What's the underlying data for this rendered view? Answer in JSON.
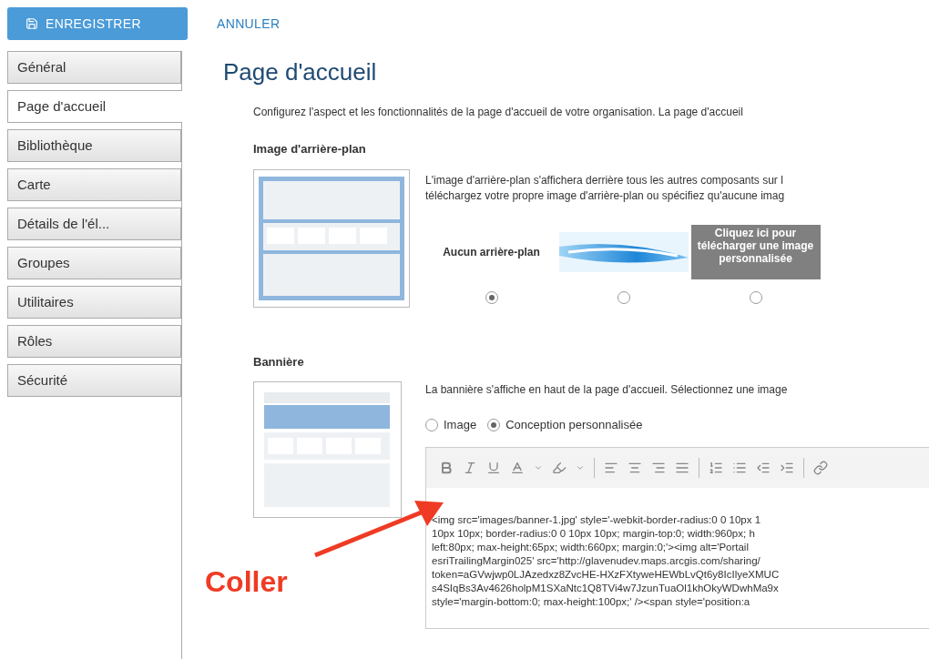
{
  "toolbar": {
    "save": {
      "label": "ENREGISTRER"
    },
    "cancel": {
      "label": "ANNULER"
    }
  },
  "sidebar": {
    "items": [
      {
        "label": "Général",
        "selected": false
      },
      {
        "label": "Page d'accueil",
        "selected": true
      },
      {
        "label": "Bibliothèque",
        "selected": false
      },
      {
        "label": "Carte",
        "selected": false
      },
      {
        "label": "Détails de l'él...",
        "selected": false
      },
      {
        "label": "Groupes",
        "selected": false
      },
      {
        "label": "Utilitaires",
        "selected": false
      },
      {
        "label": "Rôles",
        "selected": false
      },
      {
        "label": "Sécurité",
        "selected": false
      }
    ]
  },
  "page": {
    "title": "Page d'accueil",
    "intro": "Configurez l'aspect et les fonctionnalités de la page d'accueil de votre organisation. La page d'accueil"
  },
  "background": {
    "title": "Image d'arrière-plan",
    "description": [
      "L'image d'arrière-plan s'affichera derrière tous les autres composants sur l",
      "téléchargez votre propre image d'arrière-plan ou spécifiez qu'aucune imag"
    ],
    "options": [
      {
        "kind": "none",
        "label": "Aucun arrière-plan",
        "selected": true
      },
      {
        "kind": "swoosh",
        "selected": false
      },
      {
        "kind": "upload",
        "label": "Cliquez ici pour télécharger une image personnalisée",
        "selected": false
      }
    ]
  },
  "banner": {
    "title": "Bannière",
    "description": "La bannière s'affiche en haut de la page d'accueil. Sélectionnez une image",
    "options": [
      {
        "label": "Image",
        "selected": false
      },
      {
        "label": "Conception personnalisée",
        "selected": true
      }
    ],
    "code_lines": [
      "<img src='images/banner-1.jpg' style='-webkit-border-radius:0 0 10px 1",
      "10px 10px; border-radius:0 0 10px 10px; margin-top:0; width:960px; h",
      "left:80px; max-height:65px; width:660px; margin:0;'><img alt='Portail",
      "esriTrailingMargin025' src='http://glavenudev.maps.arcgis.com/sharing/",
      "token=aGVwjwp0LJAzedxz8ZvcHE-HXzFXtyweHEWbLvQt6y8IcIlyeXMUC",
      "s4SIqBs3Av4626holpM1SXaNtc1Q8TVi4w7JzunTuaOl1khOkyWDwhMa9x",
      "style='margin-bottom:0; max-height:100px;' /><span style='position:a"
    ]
  },
  "annotation": {
    "label": "Coller"
  }
}
